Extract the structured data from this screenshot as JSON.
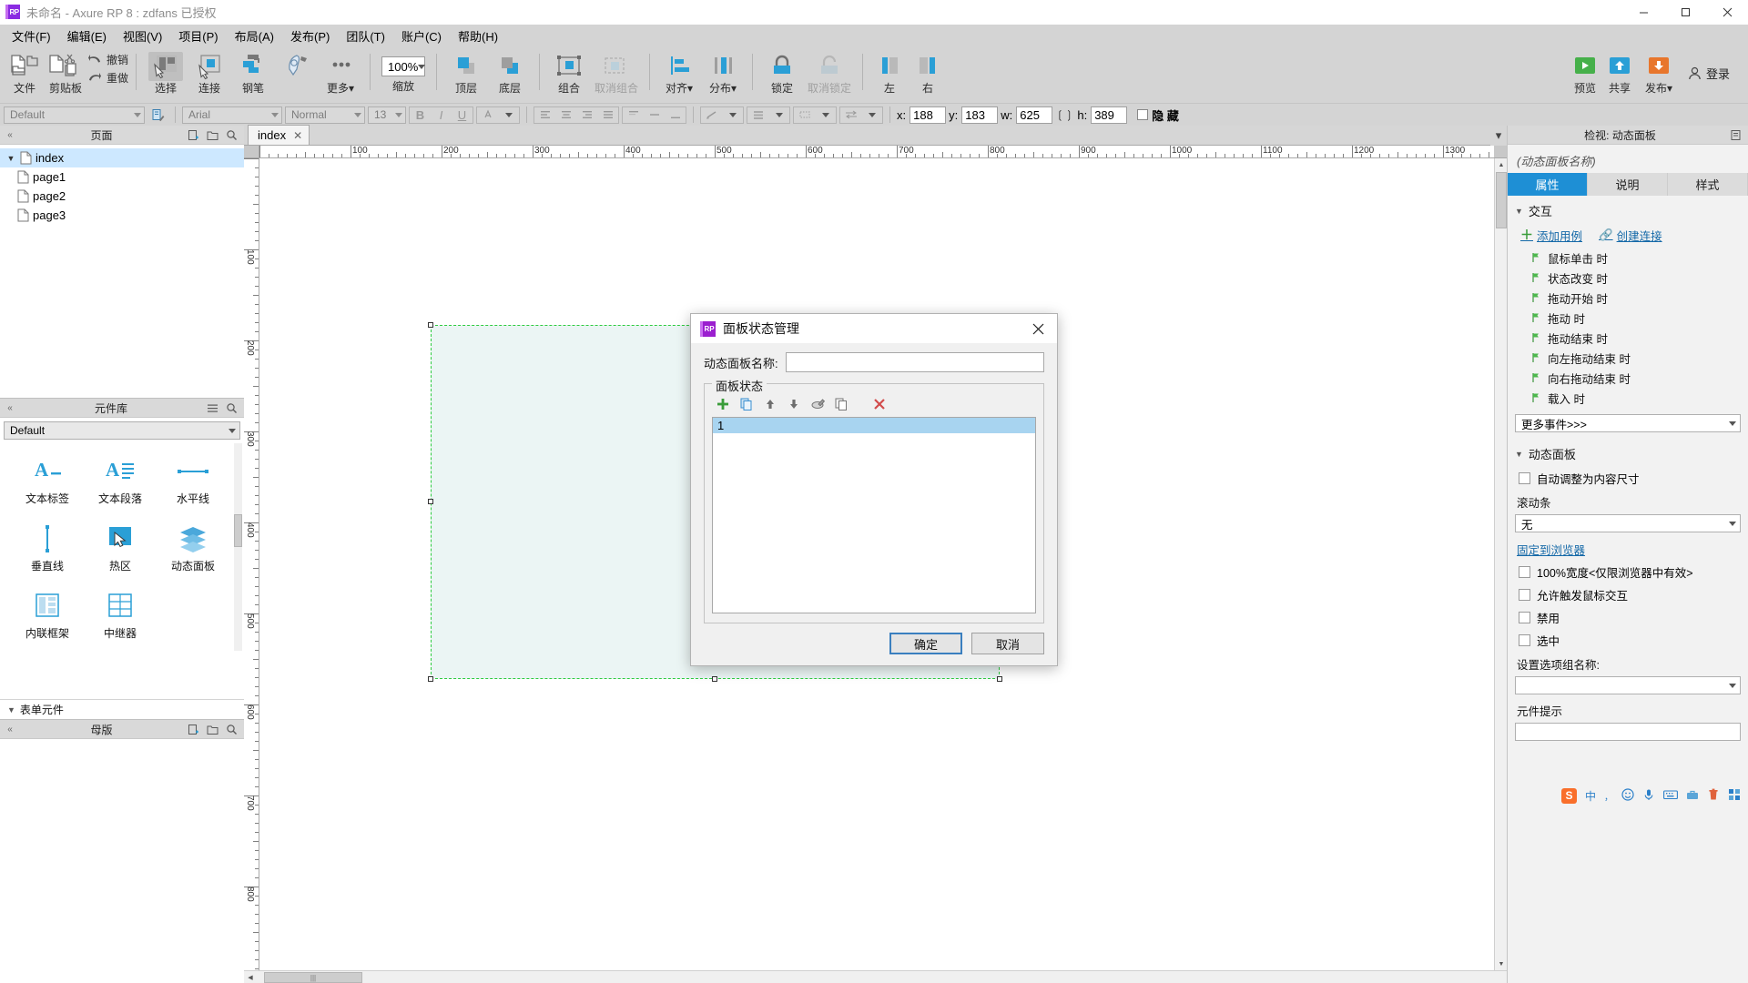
{
  "window": {
    "title": "未命名 - Axure RP 8  : zdfans 已授权",
    "logo_text": "RP",
    "minimize": "—",
    "maximize": "□",
    "close": "✕"
  },
  "menubar": {
    "items": [
      {
        "label": "文件(F)",
        "name": "menu-file"
      },
      {
        "label": "编辑(E)",
        "name": "menu-edit"
      },
      {
        "label": "视图(V)",
        "name": "menu-view"
      },
      {
        "label": "项目(P)",
        "name": "menu-project"
      },
      {
        "label": "布局(A)",
        "name": "menu-layout"
      },
      {
        "label": "发布(P)",
        "name": "menu-publish"
      },
      {
        "label": "团队(T)",
        "name": "menu-team"
      },
      {
        "label": "账户(C)",
        "name": "menu-account"
      },
      {
        "label": "帮助(H)",
        "name": "menu-help"
      }
    ]
  },
  "toolbar": {
    "file_label": "文件",
    "clipboard_label": "剪贴板",
    "undo_label": "撤销",
    "redo_label": "重做",
    "select_label": "选择",
    "connect_label": "连接",
    "pen_label": "钢笔",
    "more_label": "更多",
    "zoom_label": "缩放",
    "zoom_value": "100%",
    "front_label": "顶层",
    "back_label": "底层",
    "group_label": "组合",
    "ungroup_label": "取消组合",
    "align_label": "对齐",
    "distribute_label": "分布",
    "lock_label": "锁定",
    "unlock_label": "取消锁定",
    "left_label": "左",
    "right_label": "右",
    "preview_label": "预览",
    "share_label": "共享",
    "publish_label": "发布",
    "login_label": "登录"
  },
  "formatbar": {
    "style_value": "Default",
    "font_value": "Arial",
    "weight_value": "Normal",
    "size_value": "13",
    "bold": "B",
    "italic": "I",
    "underline": "U",
    "x_label": "x:",
    "x_value": "188",
    "y_label": "y:",
    "y_value": "183",
    "w_label": "w:",
    "w_value": "625",
    "h_label": "h:",
    "h_value": "389",
    "hide_label": "隐 藏"
  },
  "pages_panel": {
    "title": "页面",
    "icons": [
      "add-page-icon",
      "folder-icon",
      "search-icon"
    ],
    "tree": [
      {
        "label": "index",
        "level": 0,
        "selected": true,
        "expanded": true
      },
      {
        "label": "page1",
        "level": 1,
        "selected": false
      },
      {
        "label": "page2",
        "level": 1,
        "selected": false
      },
      {
        "label": "page3",
        "level": 1,
        "selected": false
      }
    ]
  },
  "widgets_panel": {
    "title": "元件库",
    "library_value": "Default",
    "items": [
      {
        "label": "文本标签",
        "icon": "text-label-icon"
      },
      {
        "label": "文本段落",
        "icon": "text-paragraph-icon"
      },
      {
        "label": "水平线",
        "icon": "horizontal-line-icon"
      },
      {
        "label": "垂直线",
        "icon": "vertical-line-icon"
      },
      {
        "label": "热区",
        "icon": "hotspot-icon"
      },
      {
        "label": "动态面板",
        "icon": "dynamic-panel-icon"
      },
      {
        "label": "内联框架",
        "icon": "inline-frame-icon"
      },
      {
        "label": "中继器",
        "icon": "repeater-icon"
      }
    ],
    "section_form": "表单元件"
  },
  "masters_panel": {
    "title": "母版"
  },
  "canvas": {
    "tab_label": "index",
    "tab_close": "✕",
    "ruler_h": [
      "100",
      "200",
      "300",
      "400",
      "500",
      "600",
      "700",
      "800",
      "900",
      "1000",
      "1100",
      "1200",
      "1300"
    ],
    "ruler_v": [
      "100",
      "200",
      "300",
      "400",
      "500",
      "600",
      "700",
      "800"
    ],
    "scroll_grip": "|||"
  },
  "inspector": {
    "header_title": "检视: 动态面板",
    "object_name": "(动态面板名称)",
    "tabs": [
      {
        "label": "属性",
        "active": true
      },
      {
        "label": "说明",
        "active": false
      },
      {
        "label": "样式",
        "active": false
      }
    ],
    "interaction": {
      "section_label": "交互",
      "add_case_label": "添加用例",
      "create_link_label": "创建连接",
      "events": [
        "鼠标单击 时",
        "状态改变 时",
        "拖动开始 时",
        "拖动 时",
        "拖动结束 时",
        "向左拖动结束 时",
        "向右拖动结束 时",
        "载入 时"
      ],
      "more_events": "更多事件>>>"
    },
    "dynamic_panel": {
      "section_label": "动态面板",
      "auto_fit_label": "自动调整为内容尺寸",
      "scrollbar_label": "滚动条",
      "scrollbar_value": "无",
      "pin_to_browser": "固定到浏览器",
      "full_width_label": "100%宽度<仅限浏览器中有效>",
      "allow_mouse_label": "允许触发鼠标交互",
      "disabled_label": "禁用",
      "selected_label": "选中",
      "group_name_label": "设置选项组名称:",
      "group_name_value": "",
      "tooltip_label": "元件提示",
      "tooltip_value": ""
    }
  },
  "dialog": {
    "logo_text": "RP",
    "title": "面板状态管理",
    "close": "✕",
    "panel_name_label": "动态面板名称:",
    "panel_name_value": "",
    "panel_name_placeholder": "",
    "states_label": "面板状态",
    "toolbar_icons": [
      {
        "name": "add-state-icon",
        "glyph": "✚",
        "color": "#3a9c3a"
      },
      {
        "name": "duplicate-state-icon",
        "glyph": "❐",
        "color": "#3a8fd0"
      },
      {
        "name": "move-up-icon",
        "glyph": "⬆",
        "color": "#5c5c5c"
      },
      {
        "name": "move-down-icon",
        "glyph": "⬇",
        "color": "#5c5c5c"
      },
      {
        "name": "edit-state-icon",
        "glyph": "✎",
        "color": "#4a4a4a"
      },
      {
        "name": "duplicate-multi-icon",
        "glyph": "⧉",
        "color": "#4a4a4a"
      },
      {
        "name": "delete-state-icon",
        "glyph": "✕",
        "color": "#cc3333"
      }
    ],
    "states": [
      {
        "label": "1",
        "selected": true
      }
    ],
    "ok_label": "确定",
    "cancel_label": "取消"
  },
  "ime": {
    "logo": "S",
    "mode_label": "中",
    "comma_label": "，",
    "items": [
      "smiley-icon",
      "mic-icon",
      "keyboard-icon",
      "toolbox-icon",
      "trash-icon",
      "apps-icon"
    ]
  },
  "colors": {
    "accent_blue": "#1e8fd5",
    "link_blue": "#1569a8",
    "selection_green": "#2ecc40",
    "purple": "#9b1fcf",
    "panel_grey": "#d4d4d4"
  }
}
